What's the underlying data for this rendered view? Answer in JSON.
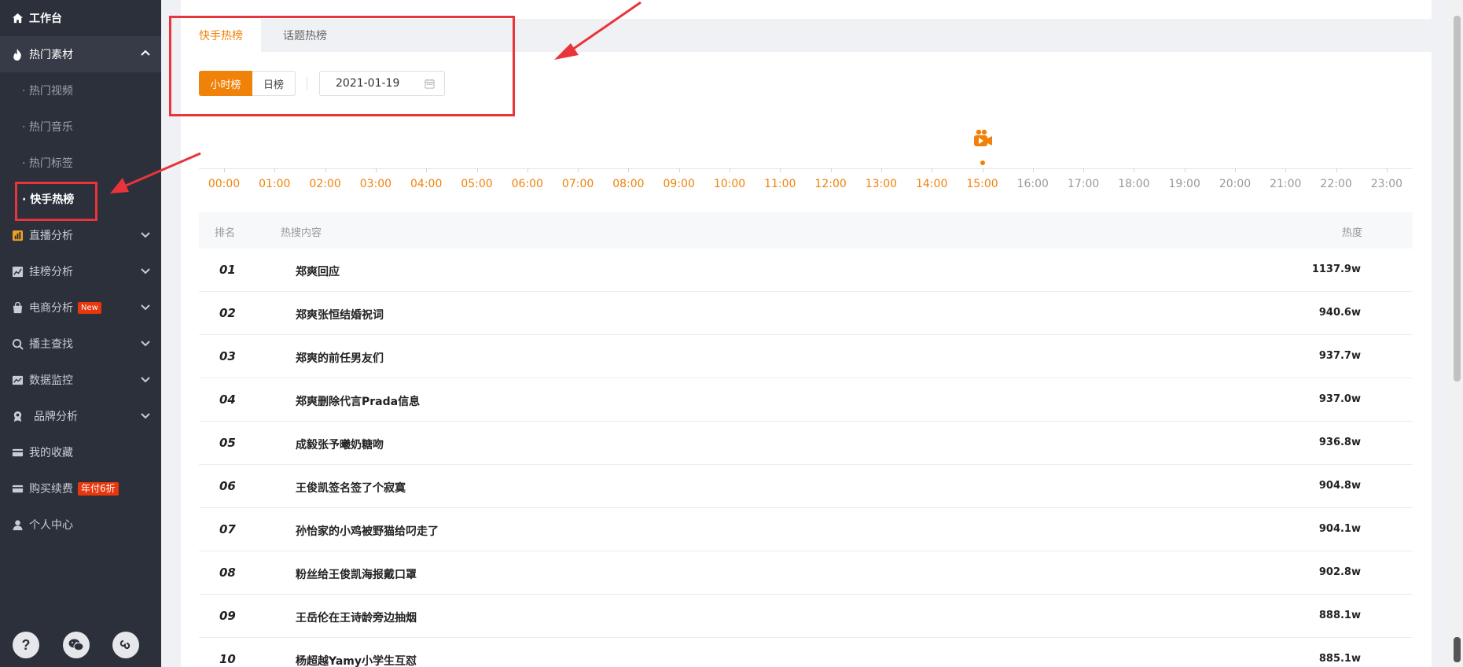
{
  "sidebar": {
    "workbench": "工作台",
    "hot_material": "热门素材",
    "sub_items": [
      "· 热门视频",
      "· 热门音乐",
      "· 热门标签",
      "· 快手热榜"
    ],
    "live_analysis": "直播分析",
    "ranking_analysis": "挂榜分析",
    "ecommerce_analysis": "电商分析",
    "ecommerce_badge": "New",
    "anchor_search": "播主查找",
    "data_monitor": "数据监控",
    "brand_analysis": "品牌分析",
    "my_favorites": "我的收藏",
    "purchase": "购买续费",
    "purchase_badge": "年付6折",
    "personal_center": "个人中心"
  },
  "tabs": [
    "快手热榜",
    "话题热榜"
  ],
  "filters": {
    "hourly": "小时榜",
    "daily": "日榜",
    "date": "2021-01-19"
  },
  "timeline": {
    "hours": [
      "00:00",
      "01:00",
      "02:00",
      "03:00",
      "04:00",
      "05:00",
      "06:00",
      "07:00",
      "08:00",
      "09:00",
      "10:00",
      "11:00",
      "12:00",
      "13:00",
      "14:00",
      "15:00",
      "16:00",
      "17:00",
      "18:00",
      "19:00",
      "20:00",
      "21:00",
      "22:00",
      "23:00"
    ],
    "current_hour": "15:00"
  },
  "table": {
    "headers": {
      "rank": "排名",
      "content": "热搜内容",
      "heat": "热度"
    },
    "rows": [
      {
        "rank": "01",
        "title": "郑爽回应",
        "heat": "1137.9w"
      },
      {
        "rank": "02",
        "title": "郑爽张恒结婚祝词",
        "heat": "940.6w"
      },
      {
        "rank": "03",
        "title": "郑爽的前任男友们",
        "heat": "937.7w"
      },
      {
        "rank": "04",
        "title": "郑爽删除代言Prada信息",
        "heat": "937.0w"
      },
      {
        "rank": "05",
        "title": "成毅张予曦奶糖吻",
        "heat": "936.8w"
      },
      {
        "rank": "06",
        "title": "王俊凯签名签了个寂寞",
        "heat": "904.8w"
      },
      {
        "rank": "07",
        "title": "孙怡家的小鸡被野猫给叼走了",
        "heat": "904.1w"
      },
      {
        "rank": "08",
        "title": "粉丝给王俊凯海报戴口罩",
        "heat": "902.8w"
      },
      {
        "rank": "09",
        "title": "王岳伦在王诗龄旁边抽烟",
        "heat": "888.1w"
      },
      {
        "rank": "10",
        "title": "杨超越Yamy小学生互怼",
        "heat": "885.1w"
      }
    ]
  },
  "colors": {
    "accent": "#f08209",
    "sidebar_bg": "#2b303b",
    "annotation": "#e8343a"
  }
}
